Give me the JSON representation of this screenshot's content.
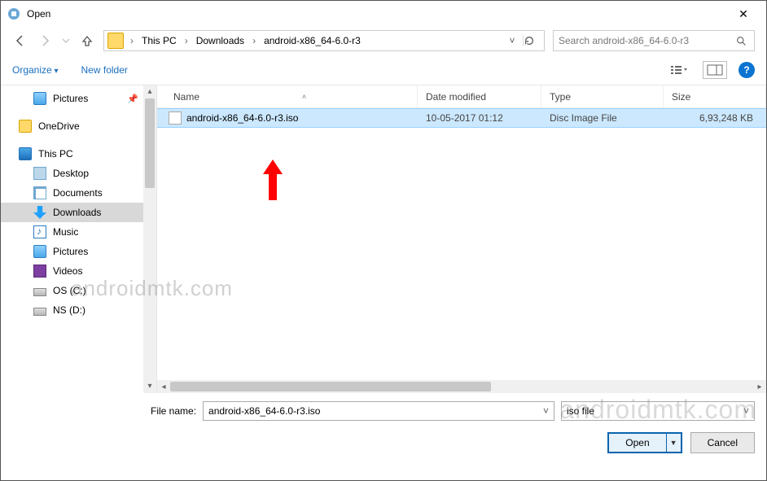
{
  "window": {
    "title": "Open"
  },
  "breadcrumbs": [
    "This PC",
    "Downloads",
    "android-x86_64-6.0-r3"
  ],
  "search": {
    "placeholder": "Search android-x86_64-6.0-r3"
  },
  "toolbar": {
    "organize": "Organize",
    "newfolder": "New folder"
  },
  "sidebar": {
    "items": [
      {
        "label": "Pictures",
        "icon": "pics",
        "pinned": true
      },
      {
        "label": "OneDrive",
        "icon": "onedrive"
      },
      {
        "label": "This PC",
        "icon": "thispc"
      },
      {
        "label": "Desktop",
        "icon": "desktop"
      },
      {
        "label": "Documents",
        "icon": "docs"
      },
      {
        "label": "Downloads",
        "icon": "dl",
        "selected": true
      },
      {
        "label": "Music",
        "icon": "music"
      },
      {
        "label": "Pictures",
        "icon": "pics"
      },
      {
        "label": "Videos",
        "icon": "vids"
      },
      {
        "label": "OS (C:)",
        "icon": "drive"
      },
      {
        "label": "NS (D:)",
        "icon": "drive"
      }
    ]
  },
  "columns": {
    "name": "Name",
    "date": "Date modified",
    "type": "Type",
    "size": "Size"
  },
  "files": [
    {
      "name": "android-x86_64-6.0-r3.iso",
      "date": "10-05-2017 01:12",
      "type": "Disc Image File",
      "size": "6,93,248 KB",
      "selected": true
    }
  ],
  "footer": {
    "filename_label": "File name:",
    "filename_value": "android-x86_64-6.0-r3.iso",
    "filter": "iso file",
    "open": "Open",
    "cancel": "Cancel"
  },
  "watermark": "androidmtk.com"
}
